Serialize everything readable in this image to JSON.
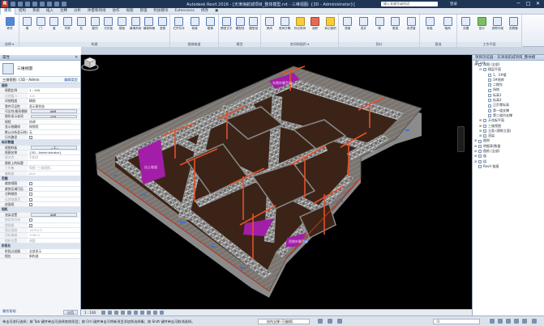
{
  "titlebar": {
    "app_title": "Autodesk Revit 2016 - [天津海航城项目_整体模型.rvt - 三维视图: {3D - Administrator}]",
    "search_placeholder": "键入关键字或短语",
    "user": "登录",
    "logo": "R",
    "min": "─",
    "max": "□",
    "close": "✕"
  },
  "ribbon_tabs": [
    "建筑",
    "结构",
    "系统",
    "插入",
    "注释",
    "分析",
    "体量和场地",
    "协作",
    "视图",
    "管理",
    "附加模块",
    "Extensions",
    "修改",
    "▣"
  ],
  "ribbon_active_tab": 0,
  "ribbon": {
    "groups": [
      {
        "label": "选择 ▾",
        "buttons": [
          {
            "label": "修改",
            "color": "blue"
          }
        ]
      },
      {
        "label": "构建",
        "buttons": [
          {
            "label": "墙",
            "color": "plain"
          },
          {
            "label": "门",
            "color": "plain"
          },
          {
            "label": "窗",
            "color": "plain"
          },
          {
            "label": "构件",
            "color": "plain"
          },
          {
            "label": "柱",
            "color": "plain"
          },
          {
            "label": "屋顶",
            "color": "plain"
          },
          {
            "label": "天花板",
            "color": "plain"
          },
          {
            "label": "楼板",
            "color": "plain"
          },
          {
            "label": "幕墙系统",
            "color": "plain"
          },
          {
            "label": "幕墙网格",
            "color": "plain"
          },
          {
            "label": "竖梃",
            "color": "plain"
          }
        ]
      },
      {
        "label": "楼梯坡道",
        "buttons": [
          {
            "label": "栏杆扶手",
            "color": "plain"
          },
          {
            "label": "坡道",
            "color": "plain"
          },
          {
            "label": "楼梯",
            "color": "plain"
          }
        ]
      },
      {
        "label": "模型",
        "buttons": [
          {
            "label": "模型文字",
            "color": "plain"
          },
          {
            "label": "模型线",
            "color": "plain"
          },
          {
            "label": "模型组",
            "color": "plain"
          }
        ]
      },
      {
        "label": "房间和面积 ▾",
        "buttons": [
          {
            "label": "房间",
            "color": "plain"
          },
          {
            "label": "房间分隔",
            "color": "plain"
          },
          {
            "label": "标记房间",
            "color": "yellow"
          },
          {
            "label": "面积",
            "color": "red"
          },
          {
            "label": "标记面积",
            "color": "yellow"
          }
        ]
      },
      {
        "label": "洞口",
        "buttons": [
          {
            "label": "按面",
            "color": "plain"
          },
          {
            "label": "竖井",
            "color": "plain"
          },
          {
            "label": "墙",
            "color": "plain"
          },
          {
            "label": "垂直",
            "color": "plain"
          },
          {
            "label": "老虎窗",
            "color": "plain"
          }
        ]
      },
      {
        "label": "基准",
        "buttons": [
          {
            "label": "标高",
            "color": "plain"
          },
          {
            "label": "轴网",
            "color": "plain"
          }
        ]
      },
      {
        "label": "工作平面",
        "buttons": [
          {
            "label": "设置",
            "color": "plain"
          },
          {
            "label": "显示",
            "color": "green"
          },
          {
            "label": "参照平面",
            "color": "plain"
          },
          {
            "label": "查看器",
            "color": "plain"
          }
        ]
      }
    ]
  },
  "properties": {
    "panel_title": "属性",
    "type_name": "三维视图",
    "view_selector": "三维视图: {3D - Admin",
    "edit_type": "编辑类型",
    "rows": [
      {
        "type": "cat",
        "k": "图形"
      },
      {
        "k": "视图比例",
        "v": "1 : 100"
      },
      {
        "k": "比例值 1:",
        "v": "100",
        "grey": true
      },
      {
        "k": "详细程度",
        "v": "精细"
      },
      {
        "k": "零件可见性",
        "v": "显示原状态"
      },
      {
        "k": "可见性/图形替换",
        "v": "编辑...",
        "btn": true
      },
      {
        "k": "图形显示选项",
        "v": "编辑...",
        "btn": true
      },
      {
        "k": "规程",
        "v": "协调"
      },
      {
        "k": "显示隐藏线",
        "v": "按规程"
      },
      {
        "k": "默认分析显示样式",
        "v": "无"
      },
      {
        "k": "日光路径",
        "check": false
      },
      {
        "type": "cat",
        "k": "标识数据"
      },
      {
        "k": "视图样板",
        "v": "<无>",
        "btn": true
      },
      {
        "k": "视图名称",
        "v": "{3D - Administrator}"
      },
      {
        "k": "相关性",
        "v": "不相关",
        "grey": true
      },
      {
        "k": "图纸上的标题",
        "v": ""
      },
      {
        "k": "工作集",
        "v": "视图 \"三维视图...",
        "grey": true
      },
      {
        "k": "编辑者",
        "v": "Jack",
        "grey": true
      },
      {
        "type": "cat",
        "k": "范围"
      },
      {
        "k": "裁剪视图",
        "check": false
      },
      {
        "k": "裁剪区域可见",
        "check": false
      },
      {
        "k": "注释裁剪",
        "check": false
      },
      {
        "k": "远剪裁激活",
        "check": false,
        "grey": true
      },
      {
        "k": "剖面框",
        "check": false
      },
      {
        "type": "cat",
        "k": "相机"
      },
      {
        "k": "渲染设置",
        "v": "编辑...",
        "btn": true
      },
      {
        "k": "锁定的方向",
        "check": false,
        "grey": true
      },
      {
        "k": "透视图",
        "check": false,
        "grey": true
      },
      {
        "k": "视点高度",
        "v": "16753.3",
        "grey": true
      },
      {
        "k": "目标高度",
        "v": "7169.2",
        "grey": true
      },
      {
        "k": "相机位置",
        "v": "调整",
        "grey": true
      },
      {
        "type": "cat",
        "k": "阶段化"
      },
      {
        "k": "阶段过滤器",
        "v": "全部显示"
      },
      {
        "k": "相位",
        "v": "新构造"
      }
    ],
    "help_link": "属性帮助",
    "apply_label": "应用"
  },
  "browser": {
    "title": "项目浏览器 - 天津海航城项目_整体模型.rvt",
    "nodes": [
      {
        "level": 0,
        "tog": "⊟",
        "label": "视图 (全部)"
      },
      {
        "level": 1,
        "tog": "⊟",
        "label": "楼层平面"
      },
      {
        "level": 2,
        "tog": "",
        "label": "1、2#楼"
      },
      {
        "level": 2,
        "tog": "",
        "label": "3#地库"
      },
      {
        "level": 2,
        "tog": "",
        "label": "二期东"
      },
      {
        "level": 2,
        "tog": "",
        "label": "场地"
      },
      {
        "level": 2,
        "tog": "",
        "label": "标高1"
      },
      {
        "level": 2,
        "tog": "",
        "label": "标高2"
      },
      {
        "level": 2,
        "tog": "",
        "label": "正负零标高"
      },
      {
        "level": 2,
        "tog": "",
        "label": "第一道支撑"
      },
      {
        "level": 2,
        "tog": "",
        "label": "第二道内支撑"
      },
      {
        "level": 1,
        "tog": "⊞",
        "label": "天花板平面"
      },
      {
        "level": 1,
        "tog": "⊞",
        "label": "三维视图"
      },
      {
        "level": 1,
        "tog": "⊞",
        "label": "立面 (建筑立面)"
      },
      {
        "level": 1,
        "tog": "⊞",
        "label": "渲染"
      },
      {
        "level": 0,
        "tog": "⊞",
        "label": "图例"
      },
      {
        "level": 0,
        "tog": "⊞",
        "label": "明细表/数量"
      },
      {
        "level": 0,
        "tog": "⊞",
        "label": "图纸 (全部)"
      },
      {
        "level": 0,
        "tog": "⊞",
        "label": "族"
      },
      {
        "level": 0,
        "tog": "⊞",
        "label": "组"
      },
      {
        "level": 0,
        "tog": "",
        "label": "Revit 链接"
      }
    ]
  },
  "viewport": {
    "text_top": "东侧外脚手架",
    "text_left": "出土坡道",
    "text_right": "西侧外脚手架"
  },
  "viewctrl": {
    "scale": "1 : 100"
  },
  "status": {
    "message": "单击可进行选择；按 Tab 键并单击可选择其他项目；按 Ctrl 键并单击可将新项目添加到选择集；按 Shift 键并单击可取消选择。",
    "workset": "结构支撑 (可编辑)",
    "filter": ":0"
  }
}
